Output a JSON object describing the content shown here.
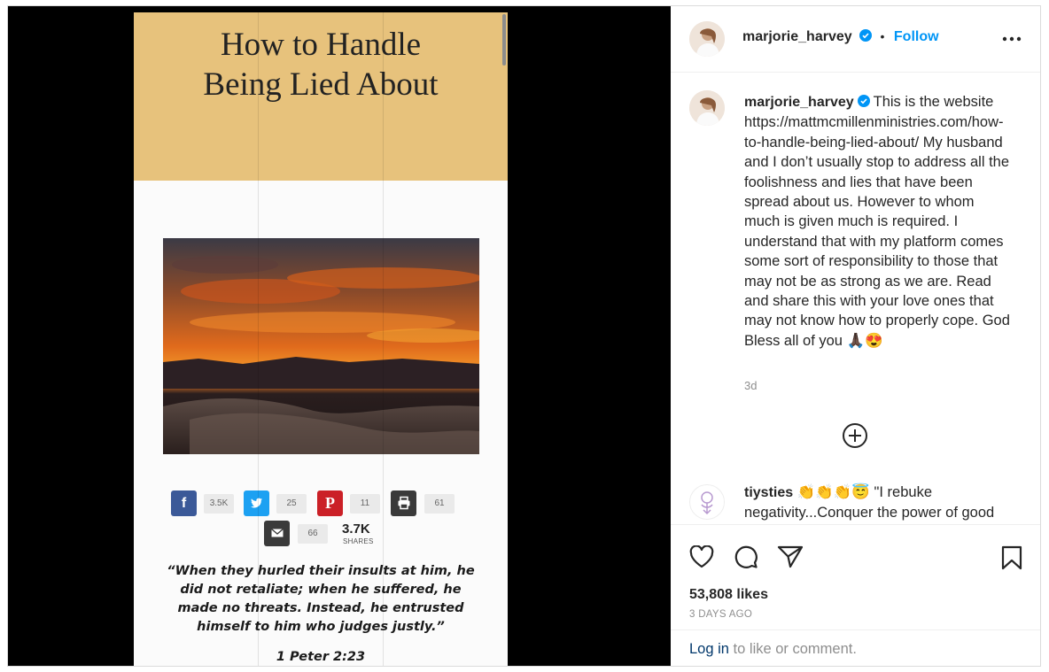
{
  "post_image": {
    "article_title_line1": "How to Handle",
    "article_title_line2": "Being Lied About",
    "share_buttons": [
      {
        "icon": "facebook-icon",
        "glyph": "f",
        "count": "3.5K",
        "color": "#3b5998"
      },
      {
        "icon": "twitter-icon",
        "glyph": "t",
        "count": "25",
        "color": "#1da1f2"
      },
      {
        "icon": "pinterest-icon",
        "glyph": "P",
        "count": "11",
        "color": "#cb2027"
      },
      {
        "icon": "print-icon",
        "glyph": "⎙",
        "count": "61",
        "color": "#3a3a3a"
      },
      {
        "icon": "email-icon",
        "glyph": "✉",
        "count": "66",
        "color": "#3a3a3a"
      }
    ],
    "total_shares": "3.7K",
    "total_shares_label": "SHARES",
    "quote_lines": [
      "“When they hurled their insults at him, he",
      "did not retaliate; when he suffered, he",
      "made no threats. Instead, he entrusted",
      "himself to him who judges justly.”"
    ],
    "quote_reference": "1 Peter 2:23"
  },
  "header": {
    "username": "marjorie_harvey",
    "separator": "•",
    "follow_label": "Follow",
    "more_icon": "more-options-icon"
  },
  "caption": {
    "username": "marjorie_harvey",
    "text": "This is the website https://mattmcmillenministries.com/how-to-handle-being-lied-about/ My husband and I don’t usually stop to address all the foolishness and lies that have been spread about us. However to whom much is given much is required. I understand that with my platform comes some sort of responsibility to those that may not be as strong as we are. Read and share this with your love ones that may not know how to properly cope. God Bless all of you",
    "emojis": "🙏🏿😍",
    "time": "3d"
  },
  "load_more_icon": "add-circle-icon",
  "comment": {
    "username": "tiysties",
    "emojis": "👏👏👏😇",
    "text": "\"I rebuke negativity...Conquer the power of good"
  },
  "actions": {
    "icons": [
      "like-heart-icon",
      "comment-bubble-icon",
      "share-paper-plane-icon",
      "save-bookmark-icon"
    ],
    "likes": "53,808 likes",
    "posted_ago": "3 DAYS AGO"
  },
  "login_prompt": {
    "link": "Log in",
    "rest": " to like or comment."
  },
  "colors": {
    "accent": "#0095f6",
    "verified": "#0095f6",
    "article_header": "#e7c27c"
  }
}
